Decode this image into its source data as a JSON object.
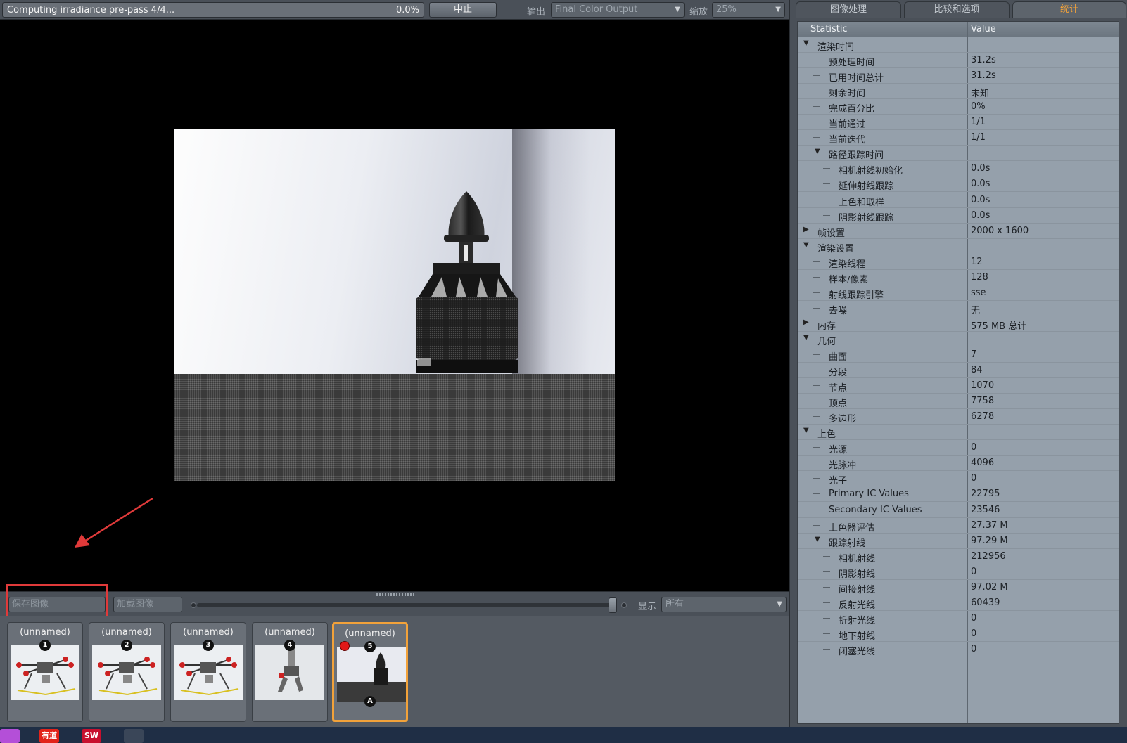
{
  "toolbar": {
    "progress_text": "Computing irradiance pre-pass 4/4...",
    "progress_pct_text": "0.0%",
    "progress_value": 0.0,
    "stop_label": "中止",
    "output_label": "输出",
    "output_value": "Final Color Output",
    "zoom_label": "缩放",
    "zoom_value": "25%"
  },
  "bottom": {
    "save_label": "保存图像",
    "load_label": "加载图像",
    "show_label": "显示",
    "show_value": "所有"
  },
  "thumbnails": [
    {
      "name": "(unnamed)",
      "num": "1",
      "kind": "drone"
    },
    {
      "name": "(unnamed)",
      "num": "2",
      "kind": "drone"
    },
    {
      "name": "(unnamed)",
      "num": "3",
      "kind": "drone"
    },
    {
      "name": "(unnamed)",
      "num": "4",
      "kind": "arm"
    },
    {
      "name": "(unnamed)",
      "num": "5",
      "kind": "motor",
      "badge": "A"
    }
  ],
  "tabs": [
    "图像处理",
    "比较和选项",
    "统计"
  ],
  "stats_header": {
    "name": "Statistic",
    "value": "Value"
  },
  "stats": [
    {
      "name": "渲染时间",
      "value": "",
      "level": 0,
      "toggle": "▼"
    },
    {
      "name": "预处理时间",
      "value": "31.2s",
      "level": 1
    },
    {
      "name": "已用时间总计",
      "value": "31.2s",
      "level": 1
    },
    {
      "name": "剩余时间",
      "value": "未知",
      "level": 1
    },
    {
      "name": "完成百分比",
      "value": "0%",
      "level": 1
    },
    {
      "name": "当前通过",
      "value": "1/1",
      "level": 1
    },
    {
      "name": "当前迭代",
      "value": "1/1",
      "level": 1
    },
    {
      "name": "路径跟踪时间",
      "value": "",
      "level": 1,
      "toggle": "▼"
    },
    {
      "name": "相机射线初始化",
      "value": "0.0s",
      "level": 2
    },
    {
      "name": "延伸射线跟踪",
      "value": "0.0s",
      "level": 2
    },
    {
      "name": "上色和取样",
      "value": "0.0s",
      "level": 2
    },
    {
      "name": "阴影射线跟踪",
      "value": "0.0s",
      "level": 2
    },
    {
      "name": "帧设置",
      "value": "2000 x 1600",
      "level": 0,
      "toggle": "▶"
    },
    {
      "name": "渲染设置",
      "value": "",
      "level": 0,
      "toggle": "▼"
    },
    {
      "name": "渲染线程",
      "value": "12",
      "level": 1
    },
    {
      "name": "样本/像素",
      "value": "128",
      "level": 1
    },
    {
      "name": "射线跟踪引擎",
      "value": "sse",
      "level": 1
    },
    {
      "name": "去噪",
      "value": "无",
      "level": 1
    },
    {
      "name": "内存",
      "value": "575 MB 总计",
      "level": 0,
      "toggle": "▶"
    },
    {
      "name": "几何",
      "value": "",
      "level": 0,
      "toggle": "▼"
    },
    {
      "name": "曲面",
      "value": "7",
      "level": 1
    },
    {
      "name": "分段",
      "value": "84",
      "level": 1
    },
    {
      "name": "节点",
      "value": "1070",
      "level": 1
    },
    {
      "name": "顶点",
      "value": "7758",
      "level": 1
    },
    {
      "name": "多边形",
      "value": "6278",
      "level": 1
    },
    {
      "name": "上色",
      "value": "",
      "level": 0,
      "toggle": "▼"
    },
    {
      "name": "光源",
      "value": "0",
      "level": 1
    },
    {
      "name": "光脉冲",
      "value": "4096",
      "level": 1
    },
    {
      "name": "光子",
      "value": "0",
      "level": 1
    },
    {
      "name": "Primary IC Values",
      "value": "22795",
      "level": 1
    },
    {
      "name": "Secondary IC Values",
      "value": "23546",
      "level": 1
    },
    {
      "name": "上色器评估",
      "value": "27.37 M",
      "level": 1
    },
    {
      "name": "跟踪射线",
      "value": "97.29 M",
      "level": 1,
      "toggle": "▼"
    },
    {
      "name": "相机射线",
      "value": "212956",
      "level": 2
    },
    {
      "name": "阴影射线",
      "value": "0",
      "level": 2
    },
    {
      "name": "间接射线",
      "value": "97.02 M",
      "level": 2
    },
    {
      "name": "反射光线",
      "value": "60439",
      "level": 2
    },
    {
      "name": "折射光线",
      "value": "0",
      "level": 2
    },
    {
      "name": "地下射线",
      "value": "0",
      "level": 2
    },
    {
      "name": "闭塞光线",
      "value": "0",
      "level": 2
    }
  ],
  "taskbar": [
    {
      "label": "",
      "color": "#b44fd8",
      "icon": "app-circle-icon"
    },
    {
      "label": "有道",
      "color": "#e2231a",
      "icon": "youdao-icon"
    },
    {
      "label": "SW",
      "color": "#c8102e",
      "icon": "solidworks-icon"
    },
    {
      "label": "",
      "color": "#3a4658",
      "icon": "render-app-icon"
    }
  ],
  "colors": {
    "accent": "#f2a23a",
    "highlight": "#e03a3a"
  }
}
